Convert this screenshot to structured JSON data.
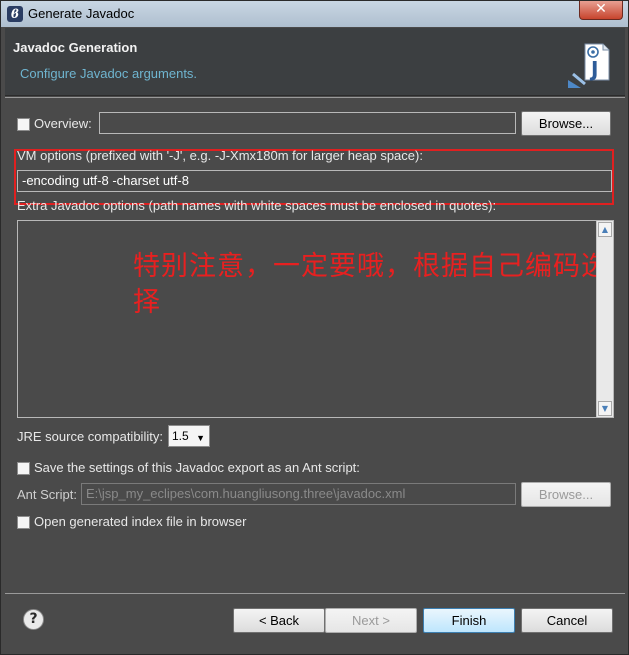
{
  "window": {
    "title": "Generate Javadoc",
    "close_glyph": "✕"
  },
  "header": {
    "title": "Javadoc Generation",
    "subtitle": "Configure Javadoc arguments.",
    "icon": "javadoc-wizard-icon"
  },
  "overview": {
    "label": "Overview:",
    "value": "",
    "browse_label": "Browse..."
  },
  "vm_options": {
    "label": "VM options (prefixed with '-J', e.g. -J-Xmx180m for larger heap space):",
    "value": "-encoding utf-8 -charset utf-8"
  },
  "extra_options": {
    "label": "Extra Javadoc options (path names with white spaces must be enclosed in quotes):",
    "value": ""
  },
  "annotation": {
    "line1": "特别注意，一定要哦，根据自己编码选",
    "line2": "择",
    "color": "#e82020"
  },
  "jre": {
    "label": "JRE source compatibility:",
    "value": "1.5"
  },
  "ant": {
    "save_label": "Save the settings of this Javadoc export as an Ant script:",
    "script_label": "Ant Script:",
    "script_value": "E:\\jsp_my_eclipes\\com.huangliusong.three\\javadoc.xml",
    "browse_label": "Browse..."
  },
  "open_index": {
    "label": "Open generated index file in browser"
  },
  "buttons": {
    "help": "?",
    "back": "< Back",
    "next": "Next >",
    "finish": "Finish",
    "cancel": "Cancel"
  }
}
